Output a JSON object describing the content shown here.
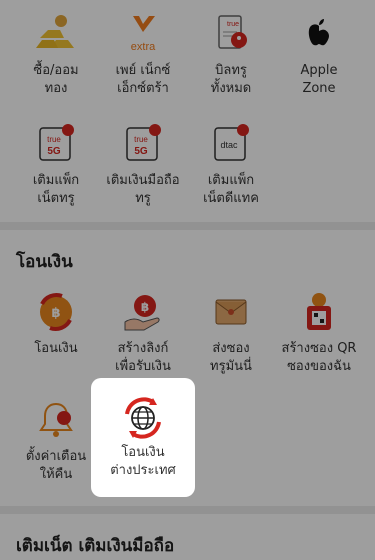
{
  "top_grid": [
    {
      "label_1": "ซื้อ/ออม",
      "label_2": "ทอง",
      "icon": "gold-bars-icon"
    },
    {
      "label_1": "เพย์ เน็กซ์",
      "label_2": "เอ็กซ์ตร้า",
      "icon": "pay-next-extra-icon",
      "icon_text": "extra"
    },
    {
      "label_1": "บิลทรู",
      "label_2": "ทั้งหมด",
      "icon": "true-bill-icon",
      "icon_text": "true"
    },
    {
      "label_1": "Apple",
      "label_2": "Zone",
      "icon": "apple-icon"
    },
    {
      "label_1": "เติมแพ็ก",
      "label_2": "เน็ตทรู",
      "icon": "true-5g-card-icon",
      "icon_text": "true"
    },
    {
      "label_1": "เติมเงินมือถือ",
      "label_2": "ทรู",
      "icon": "true-5g-topup-icon",
      "icon_text": "true"
    },
    {
      "label_1": "เติมแพ็ก",
      "label_2": "เน็ตดีแทค",
      "icon": "dtac-card-icon",
      "icon_text": "dtac"
    }
  ],
  "transfer_section": {
    "title": "โอนเงิน",
    "items": [
      {
        "label_1": "โอนเงิน",
        "label_2": "",
        "icon": "coin-transfer-icon"
      },
      {
        "label_1": "สร้างลิงก์",
        "label_2": "เพื่อรับเงิน",
        "icon": "receive-link-icon"
      },
      {
        "label_1": "ส่งซอง",
        "label_2": "ทรูมันนี่",
        "icon": "envelope-icon"
      },
      {
        "label_1": "สร้างซอง QR",
        "label_2": "ซองของฉัน",
        "icon": "qr-envelope-icon"
      },
      {
        "label_1": "ตั้งค่าเตือน",
        "label_2": "ให้คืน",
        "icon": "reminder-bell-icon"
      }
    ],
    "highlight": {
      "label_1": "โอนเงิน",
      "label_2": "ต่างประเทศ",
      "icon": "international-transfer-icon"
    }
  },
  "next_section": {
    "title": "เติมเน็ต เติมเงินมือถือ"
  }
}
